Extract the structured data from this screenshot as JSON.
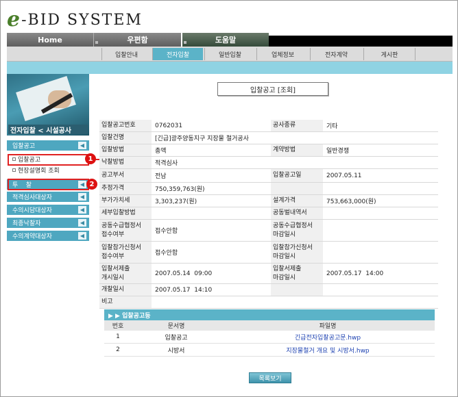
{
  "logo": {
    "e": "e",
    "text": "-BID SYSTEM"
  },
  "top_tabs": [
    "Home",
    "우편함",
    "도움말"
  ],
  "sub_menu": [
    "입찰안내",
    "전자입찰",
    "일반입찰",
    "업체정보",
    "전자계약",
    "게시판"
  ],
  "sub_menu_active": "전자입찰",
  "left": {
    "banner_title": "전자입찰 < 시설공사",
    "menu1": "입찰공고",
    "sub_items": [
      "입찰공고",
      "현장설명회 조회"
    ],
    "menus": [
      "투    찰",
      "적격심사대상자",
      "수의시담대상자",
      "최종낙찰자",
      "수의계약대상자"
    ]
  },
  "callouts": [
    "1",
    "2"
  ],
  "page_title": "입찰공고 [조회]",
  "form": {
    "r1": [
      "입찰공고번호",
      "0762031",
      "공사종류",
      "기타"
    ],
    "r2": [
      "입찰건명",
      "[긴급]광주양동지구 지장물 철거공사"
    ],
    "r3": [
      "입찰방법",
      "총액",
      "계약방법",
      "일반경쟁"
    ],
    "r4": [
      "낙찰방법",
      "적격심사"
    ],
    "r5": [
      "공고부서",
      "전남",
      "입찰공고일",
      "2007.05.11"
    ],
    "r6": [
      "추정가격",
      "750,359,763(원)"
    ],
    "r7": [
      "부가가치세",
      "3,303,237(원)",
      "설계가격",
      "753,663,000(원)"
    ],
    "r8": [
      "세부입찰방법",
      "",
      "공동벌내역서",
      ""
    ],
    "r9": [
      "공동수급협정서\n접수여부",
      "접수안함",
      "공동수급협정서\n마감일시",
      ""
    ],
    "r10": [
      "입찰참가신청서\n접수여부",
      "접수안함",
      "입찰참가신청서\n마감일시",
      ""
    ],
    "r11": [
      "입찰서제출\n개시일시",
      "2007.05.14  09:00",
      "입찰서제출\n마감일시",
      "2007.05.17  14:00"
    ],
    "r12": [
      "개찰일시",
      "2007.05.17  14:10"
    ],
    "r13": [
      "비고",
      ""
    ]
  },
  "attachments": {
    "header": "▶ ▶ 입찰공고등",
    "columns": [
      "번호",
      "문서명",
      "파일명"
    ],
    "rows": [
      [
        "1",
        "입찰공고",
        "긴급전자입찰공고문.hwp"
      ],
      [
        "2",
        "시방서",
        "지장물철거 개요 및 시방서.hwp"
      ]
    ]
  },
  "list_button": "목록보기"
}
